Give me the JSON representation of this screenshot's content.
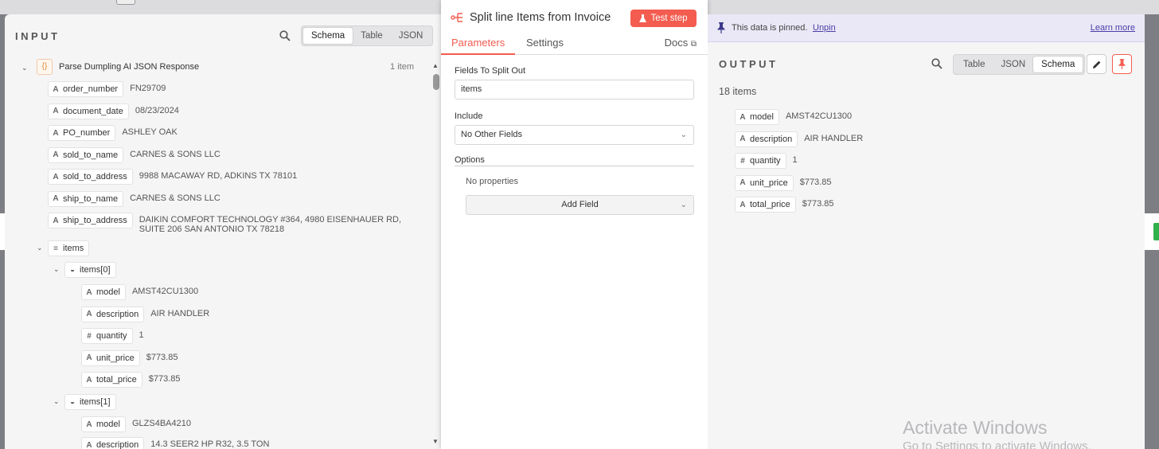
{
  "input": {
    "title": "INPUT",
    "view_tabs": [
      "Schema",
      "Table",
      "JSON"
    ],
    "active_tab": "Schema",
    "root_label": "Parse Dumpling AI JSON Response",
    "root_count": "1 item",
    "fields": [
      {
        "name": "order_number",
        "type": "A",
        "value": "FN29709"
      },
      {
        "name": "document_date",
        "type": "A",
        "value": "08/23/2024"
      },
      {
        "name": "PO_number",
        "type": "A",
        "value": "ASHLEY OAK"
      },
      {
        "name": "sold_to_name",
        "type": "A",
        "value": "CARNES & SONS LLC"
      },
      {
        "name": "sold_to_address",
        "type": "A",
        "value": "9988 MACAWAY RD, ADKINS TX 78101"
      },
      {
        "name": "ship_to_name",
        "type": "A",
        "value": "CARNES & SONS LLC"
      },
      {
        "name": "ship_to_address",
        "type": "A",
        "value": "DAIKIN COMFORT TECHNOLOGY #364, 4980 EISENHAUER RD, SUITE 206 SAN ANTONIO TX 78218"
      }
    ],
    "items_label": "items",
    "item0": {
      "label": "items[0]",
      "fields": [
        {
          "name": "model",
          "type": "A",
          "value": "AMST42CU1300"
        },
        {
          "name": "description",
          "type": "A",
          "value": "AIR HANDLER"
        },
        {
          "name": "quantity",
          "type": "#",
          "value": "1"
        },
        {
          "name": "unit_price",
          "type": "A",
          "value": "$773.85"
        },
        {
          "name": "total_price",
          "type": "A",
          "value": "$773.85"
        }
      ]
    },
    "item1": {
      "label": "items[1]",
      "fields": [
        {
          "name": "model",
          "type": "A",
          "value": "GLZS4BA4210"
        },
        {
          "name": "description",
          "type": "A",
          "value": "14.3 SEER2 HP R32, 3.5 TON"
        }
      ]
    }
  },
  "node": {
    "title": "Split line Items from Invoice",
    "test_step": "Test step",
    "tabs": {
      "parameters": "Parameters",
      "settings": "Settings",
      "docs": "Docs"
    },
    "fields_to_split_label": "Fields To Split Out",
    "fields_to_split_value": "items",
    "include_label": "Include",
    "include_value": "No Other Fields",
    "options_label": "Options",
    "no_properties": "No properties",
    "add_field": "Add Field"
  },
  "output": {
    "title": "OUTPUT",
    "pinned_text": "This data is pinned.",
    "unpin": "Unpin",
    "learn_more": "Learn more",
    "view_tabs": [
      "Table",
      "JSON",
      "Schema"
    ],
    "active_tab": "Schema",
    "items_count": "18 items",
    "fields": [
      {
        "name": "model",
        "type": "A",
        "value": "AMST42CU1300"
      },
      {
        "name": "description",
        "type": "A",
        "value": "AIR HANDLER"
      },
      {
        "name": "quantity",
        "type": "#",
        "value": "1"
      },
      {
        "name": "unit_price",
        "type": "A",
        "value": "$773.85"
      },
      {
        "name": "total_price",
        "type": "A",
        "value": "$773.85"
      }
    ]
  },
  "watermark": {
    "line1": "Activate Windows",
    "line2": "Go to Settings to activate Windows."
  },
  "colors": {
    "accent": "#f35c4f",
    "pin_banner": "#eae8f6",
    "link": "#4a3da8"
  }
}
